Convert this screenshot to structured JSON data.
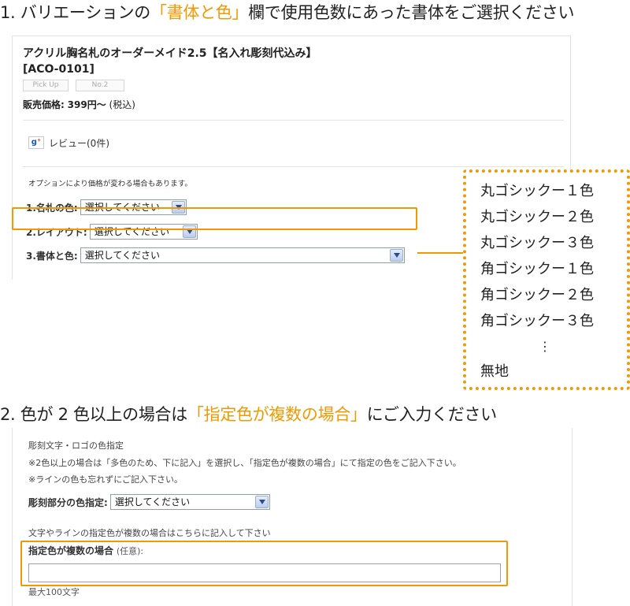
{
  "heading1": {
    "prefix": "1. バリエーションの",
    "highlight": "「書体と色」",
    "suffix": "欄で使用色数にあった書体をご選択ください"
  },
  "heading2": {
    "prefix": "2. 色が 2 色以上の場合は",
    "highlight": "「指定色が複数の場合」",
    "suffix": "にご入力ください"
  },
  "product": {
    "title": "アクリル胸名札のオーダーメイド2.5【名入れ彫刻代込み】",
    "code": "[ACO-0101]",
    "tags": [
      "Pick Up",
      "No.2"
    ],
    "price_label": "販売価格:",
    "price_value": "399円〜",
    "price_tax": "(税込)",
    "review_icon": "g+",
    "review_text": "レビュー(0件)",
    "option_note": "オプションにより価格が変わる場合もあります。",
    "options": [
      {
        "label": "1.名札の色:",
        "selected": "選択してください"
      },
      {
        "label": "2.レイアウト:",
        "selected": "選択してください"
      },
      {
        "label": "3.書体と色:",
        "selected": "選択してください"
      }
    ]
  },
  "font_list": {
    "items": [
      "丸ゴシックー１色",
      "丸ゴシックー２色",
      "丸ゴシックー３色",
      "角ゴシックー１色",
      "角ゴシックー２色",
      "角ゴシックー３色"
    ],
    "ellipsis": "⋮",
    "last": "無地"
  },
  "engraving": {
    "title": "彫刻文字・ロゴの色指定",
    "note1": "※2色以上の場合は「多色のため、下に記入」を選択し、「指定色が複数の場合」にて指定の色をご記入下さい。",
    "note2": "※ラインの色も忘れずにご記入下さい。",
    "select_label": "彫刻部分の色指定:",
    "select_value": "選択してください",
    "multi_note": "文字やラインの指定色が複数の場合はこちらに記入して下さい",
    "multi_label": "指定色が複数の場合",
    "multi_optional": "(任意):",
    "input_value": "",
    "char_limit": "最大100文字"
  },
  "colors": {
    "accent": "#f39800",
    "select_border": "#8e9eb4"
  }
}
